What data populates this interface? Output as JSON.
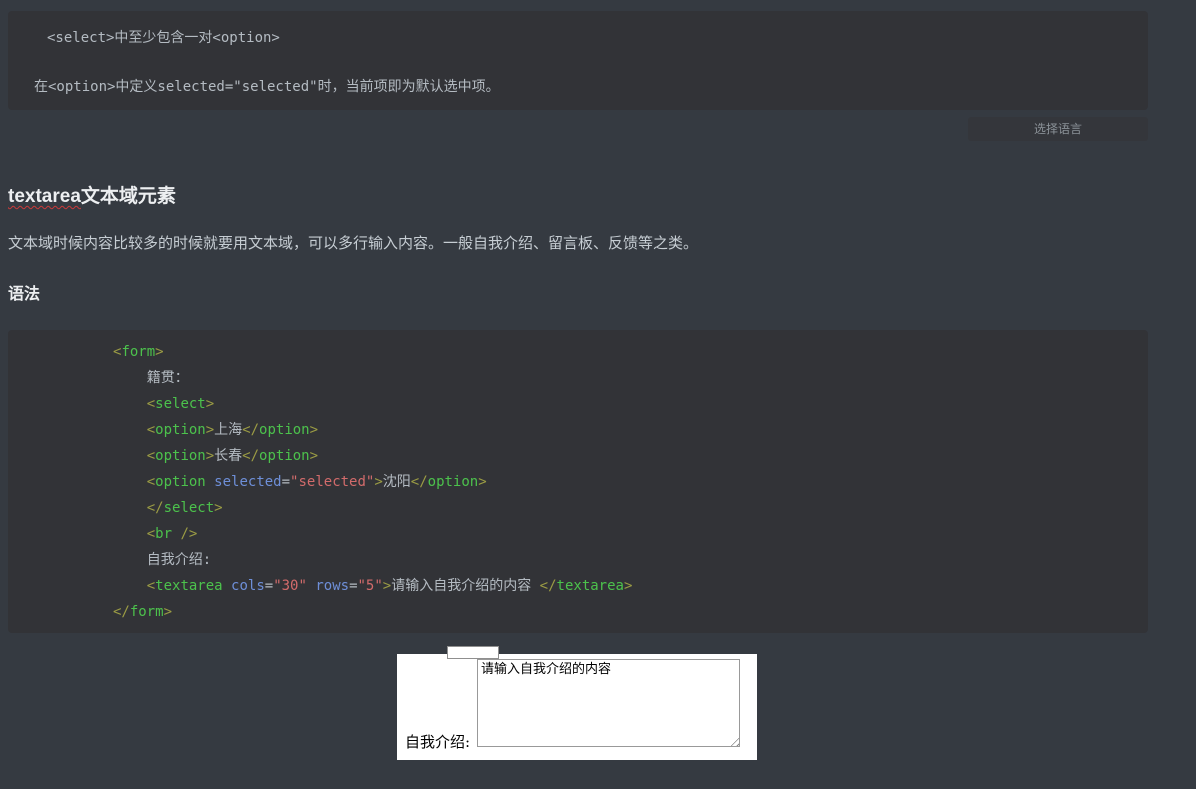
{
  "note_block": {
    "line1": "<select>中至少包含一对<option>",
    "line2": "在<option>中定义selected=\"selected\"时，当前项即为默认选中项。"
  },
  "language_button": {
    "label": "选择语言"
  },
  "section": {
    "title_highlight": "textarea",
    "title_rest": "文本域元素",
    "paragraph": "文本域时候内容比较多的时候就要用文本域，可以多行输入内容。一般自我介绍、留言板、反馈等之类。",
    "subheading": "语法"
  },
  "code_block": {
    "lines": [
      [
        {
          "c": "punct",
          "v": "<"
        },
        {
          "c": "tag",
          "v": "form"
        },
        {
          "c": "punct",
          "v": ">"
        }
      ],
      [
        {
          "c": "text",
          "v": "    籍贯："
        }
      ],
      [
        {
          "c": "text",
          "v": "    "
        },
        {
          "c": "punct",
          "v": "<"
        },
        {
          "c": "tag",
          "v": "select"
        },
        {
          "c": "punct",
          "v": ">"
        }
      ],
      [
        {
          "c": "text",
          "v": "    "
        },
        {
          "c": "punct",
          "v": "<"
        },
        {
          "c": "tag",
          "v": "option"
        },
        {
          "c": "punct",
          "v": ">"
        },
        {
          "c": "text",
          "v": "上海"
        },
        {
          "c": "punct",
          "v": "</"
        },
        {
          "c": "tag",
          "v": "option"
        },
        {
          "c": "punct",
          "v": ">"
        }
      ],
      [
        {
          "c": "text",
          "v": "    "
        },
        {
          "c": "punct",
          "v": "<"
        },
        {
          "c": "tag",
          "v": "option"
        },
        {
          "c": "punct",
          "v": ">"
        },
        {
          "c": "text",
          "v": "长春"
        },
        {
          "c": "punct",
          "v": "</"
        },
        {
          "c": "tag",
          "v": "option"
        },
        {
          "c": "punct",
          "v": ">"
        }
      ],
      [
        {
          "c": "text",
          "v": "    "
        },
        {
          "c": "punct",
          "v": "<"
        },
        {
          "c": "tag",
          "v": "option"
        },
        {
          "c": "text",
          "v": " "
        },
        {
          "c": "attr",
          "v": "selected"
        },
        {
          "c": "eq",
          "v": "="
        },
        {
          "c": "str",
          "v": "\"selected\""
        },
        {
          "c": "punct",
          "v": ">"
        },
        {
          "c": "text",
          "v": "沈阳"
        },
        {
          "c": "punct",
          "v": "</"
        },
        {
          "c": "tag",
          "v": "option"
        },
        {
          "c": "punct",
          "v": ">"
        }
      ],
      [
        {
          "c": "text",
          "v": "    "
        },
        {
          "c": "punct",
          "v": "</"
        },
        {
          "c": "tag",
          "v": "select"
        },
        {
          "c": "punct",
          "v": ">"
        }
      ],
      [
        {
          "c": "text",
          "v": "    "
        },
        {
          "c": "punct",
          "v": "<"
        },
        {
          "c": "tag",
          "v": "br"
        },
        {
          "c": "text",
          "v": " "
        },
        {
          "c": "punct",
          "v": "/>"
        }
      ],
      [
        {
          "c": "text",
          "v": "    自我介绍:"
        }
      ],
      [
        {
          "c": "text",
          "v": "    "
        },
        {
          "c": "punct",
          "v": "<"
        },
        {
          "c": "tag",
          "v": "textarea"
        },
        {
          "c": "text",
          "v": " "
        },
        {
          "c": "attr",
          "v": "cols"
        },
        {
          "c": "eq",
          "v": "="
        },
        {
          "c": "str",
          "v": "\"30\""
        },
        {
          "c": "text",
          "v": " "
        },
        {
          "c": "attr",
          "v": "rows"
        },
        {
          "c": "eq",
          "v": "="
        },
        {
          "c": "str",
          "v": "\"5\""
        },
        {
          "c": "punct",
          "v": ">"
        },
        {
          "c": "text",
          "v": "请输入自我介绍的内容 "
        },
        {
          "c": "punct",
          "v": "</"
        },
        {
          "c": "tag",
          "v": "textarea"
        },
        {
          "c": "punct",
          "v": ">"
        }
      ],
      [
        {
          "c": "punct",
          "v": "</"
        },
        {
          "c": "tag",
          "v": "form"
        },
        {
          "c": "punct",
          "v": ">"
        }
      ]
    ]
  },
  "preview": {
    "label": "自我介绍:",
    "textarea_value": "请输入自我介绍的内容 "
  },
  "colors": {
    "page-bg": "#353a41",
    "panel-bg": "#323337",
    "code-text": "#b4bbc2",
    "tag-green": "#4cc24c",
    "punct-olive": "#9b9c44",
    "attr-blue": "#6e8fd8",
    "string-red": "#d26b6b",
    "heading-text": "#edeff1",
    "body-text": "#c6cdd3",
    "button-text": "#8b9298",
    "underline-red": "#cc3a3a"
  }
}
